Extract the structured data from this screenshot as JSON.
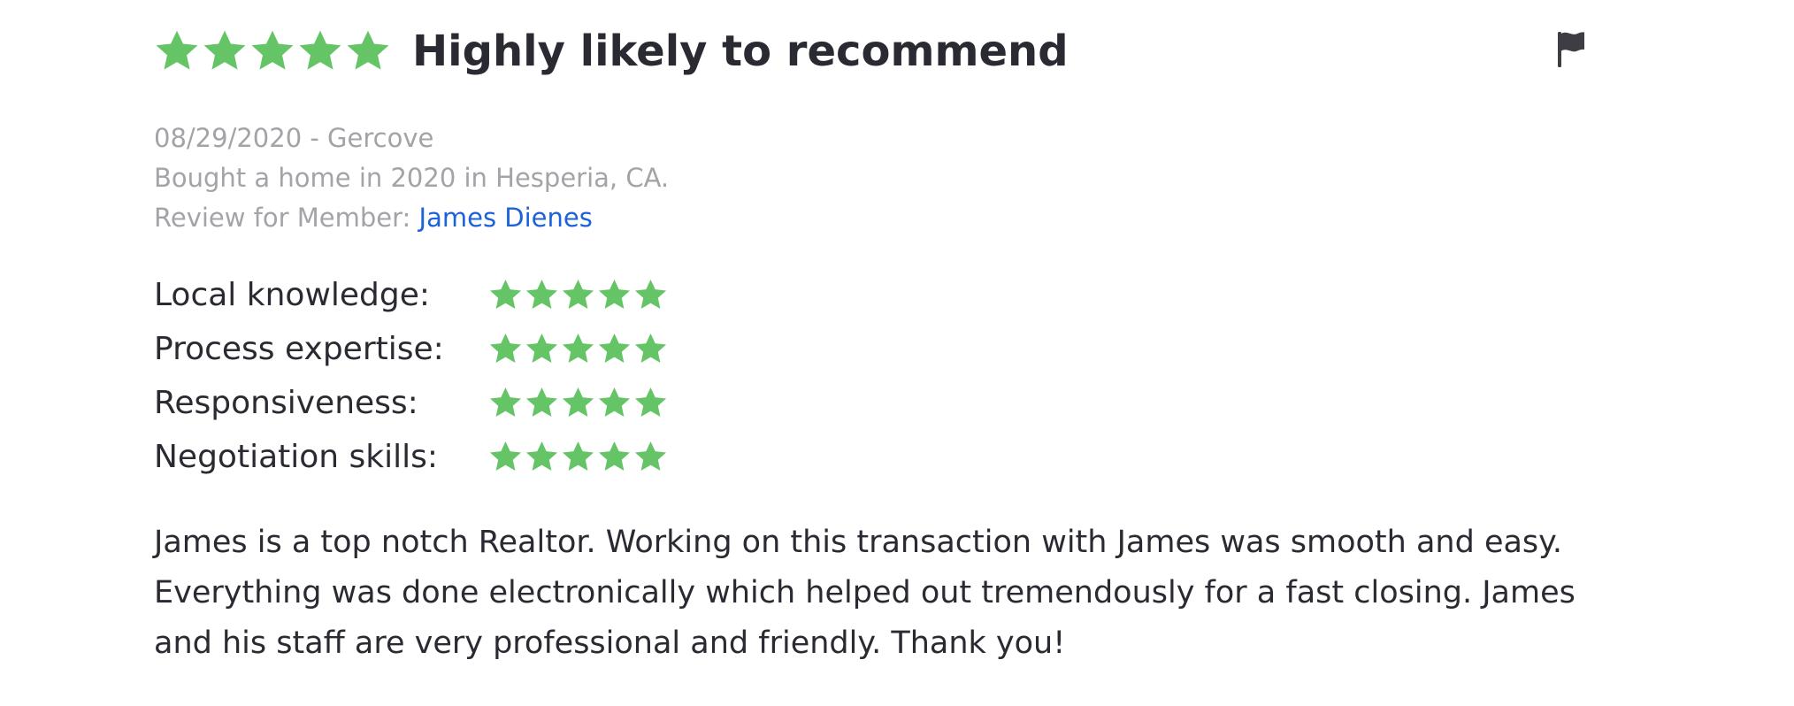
{
  "review": {
    "overall_rating": 5,
    "overall_rating_max": 5,
    "headline": "Highly likely to recommend",
    "date_author": "08/29/2020 - Gercove",
    "transaction": "Bought a home in 2020 in Hesperia, CA.",
    "member_prefix": "Review for Member: ",
    "member_name": "James Dienes",
    "sub_ratings": [
      {
        "label": "Local knowledge:",
        "stars": 5
      },
      {
        "label": "Process expertise:",
        "stars": 5
      },
      {
        "label": "Responsiveness:",
        "stars": 5
      },
      {
        "label": "Negotiation skills:",
        "stars": 5
      }
    ],
    "text_lines": [
      "James is a top notch Realtor. Working on this transaction with James was smooth and easy.",
      "Everything was done electronically which helped out tremendously for a fast closing. James",
      "and his staff are very professional and friendly. Thank you!"
    ]
  },
  "icons": {
    "star": "star-icon",
    "flag": "flag-icon"
  },
  "colors": {
    "star": "#65c466",
    "text": "#2a2a33",
    "muted": "#a3a3a8",
    "link": "#1d63d8",
    "flag": "#3d3d43"
  }
}
